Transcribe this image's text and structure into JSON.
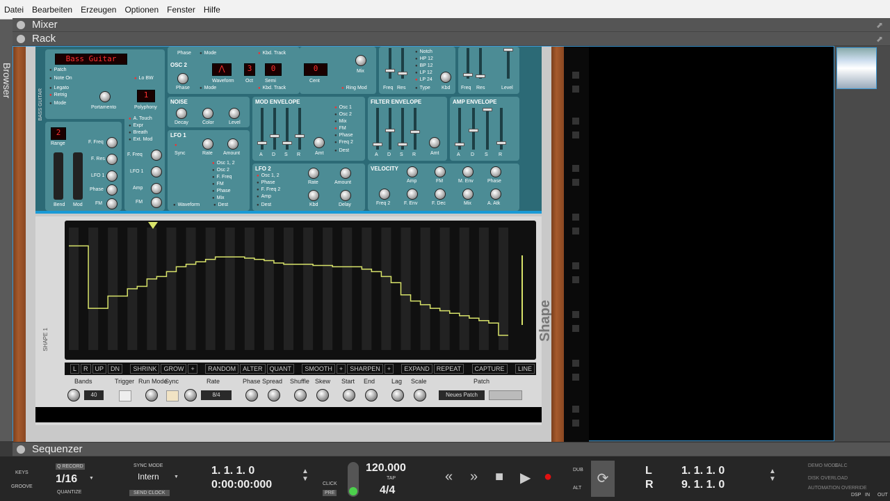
{
  "menu": [
    "Datei",
    "Bearbeiten",
    "Erzeugen",
    "Optionen",
    "Fenster",
    "Hilfe"
  ],
  "browser_label": "Browser",
  "sections": {
    "mixer": "Mixer",
    "rack": "Rack",
    "sequencer": "Sequenzer"
  },
  "synth": {
    "patch_name": "Bass Guitar",
    "patch_label": "Patch",
    "side_label": "BASS GUITAR",
    "polyphony_value": "1",
    "polyphony_label": "Polyphony",
    "range_value": "2",
    "range_label": "Range",
    "labels": {
      "note_on": "Note On",
      "lo_bw": "Lo BW",
      "legato": "Legato",
      "retrig": "Retrig",
      "mode": "Mode",
      "portamento": "Portamento",
      "a_touch": "A. Touch",
      "expr": "Expr",
      "breath": "Breath",
      "ext_mod": "Ext. Mod",
      "f_freq": "F. Freq",
      "f_res": "F. Res",
      "lfo1": "LFO 1",
      "phase": "Phase",
      "fm": "FM",
      "amp": "Amp",
      "bend": "Bend",
      "mod": "Mod"
    },
    "osc2": {
      "title": "OSC 2",
      "waveform": "Waveform",
      "oct": "Oct",
      "oct_value": "3",
      "semi": "Semi",
      "semi_value": "0",
      "cent": "Cent",
      "cent_value": "0",
      "kbd_track": "Kbd. Track",
      "ring_mod": "Ring Mod",
      "mix": "Mix",
      "phase": "Phase",
      "mode": "Mode"
    },
    "osc1_top": {
      "phase": "Phase",
      "mode": "Mode",
      "kbd_track": "Kbd. Track"
    },
    "noise": {
      "title": "NOISE",
      "decay": "Decay",
      "color": "Color",
      "level": "Level"
    },
    "lfo1": {
      "title": "LFO 1",
      "sync": "Sync",
      "rate": "Rate",
      "amount": "Amount",
      "waveform": "Waveform",
      "dest": "Dest",
      "dests": [
        "Osc 1, 2",
        "Osc 2",
        "F. Freq",
        "FM",
        "Phase",
        "Mix"
      ]
    },
    "filter_top": {
      "types": [
        "Notch",
        "HP 12",
        "BP 12",
        "LP 12",
        "LP 24"
      ],
      "freq": "Freq",
      "res": "Res",
      "type": "Type",
      "kbd": "Kbd",
      "freq2": "Freq",
      "res2": "Res",
      "level": "Level"
    },
    "mod_env": {
      "title": "MOD ENVELOPE",
      "dests": [
        "Osc 1",
        "Osc 2",
        "Mix",
        "FM",
        "Phase",
        "Freq 2"
      ],
      "dest": "Dest",
      "adsr": [
        "A",
        "D",
        "S",
        "R"
      ],
      "amt": "Amt"
    },
    "filter_env": {
      "title": "FILTER ENVELOPE",
      "adsr": [
        "A",
        "D",
        "S",
        "R"
      ],
      "amt": "Amt"
    },
    "amp_env": {
      "title": "AMP ENVELOPE",
      "adsr": [
        "A",
        "D",
        "S",
        "R"
      ]
    },
    "lfo2": {
      "title": "LFO 2",
      "dests": [
        "Osc 1, 2",
        "Phase",
        "F. Freq 2",
        "Amp"
      ],
      "dest": "Dest",
      "rate": "Rate",
      "amount": "Amount",
      "kbd": "Kbd",
      "delay": "Delay"
    },
    "velocity": {
      "title": "VELOCITY",
      "top": [
        "Amp",
        "FM",
        "M. Env",
        "Phase"
      ],
      "bottom": [
        "Freq 2",
        "F. Env",
        "F. Dec",
        "Mix",
        "A. Atk"
      ]
    }
  },
  "shape": {
    "side_label": "SHAPE 1",
    "logo": "Shape",
    "buttons_a": [
      "L",
      "R",
      "UP",
      "DN"
    ],
    "buttons_b": [
      "SHRINK",
      "GROW",
      "+"
    ],
    "buttons_c": [
      "RANDOM",
      "ALTER",
      "QUANT"
    ],
    "buttons_d": [
      "SMOOTH",
      "+",
      "SHARPEN",
      "+"
    ],
    "buttons_e": [
      "EXPAND",
      "REPEAT"
    ],
    "buttons_f": [
      "CAPTURE"
    ],
    "buttons_g": [
      "LINE"
    ],
    "controls": {
      "bands": "Bands",
      "bands_value": "40",
      "trigger": "Trigger",
      "run_mode": "Run Mode",
      "sync": "Sync",
      "rate": "Rate",
      "rate_value": "8/4",
      "phase": "Phase",
      "spread": "Spread",
      "shuffle": "Shuffle",
      "skew": "Skew",
      "start": "Start",
      "end": "End",
      "lag": "Lag",
      "scale": "Scale",
      "patch": "Patch",
      "patch_value": "Neues Patch"
    },
    "curve": [
      0.85,
      0.85,
      0.34,
      0.34,
      0.44,
      0.44,
      0.5,
      0.52,
      0.58,
      0.6,
      0.64,
      0.68,
      0.7,
      0.72,
      0.74,
      0.76,
      0.76,
      0.76,
      0.75,
      0.74,
      0.73,
      0.71,
      0.7,
      0.7,
      0.7,
      0.69,
      0.69,
      0.68,
      0.68,
      0.68,
      0.66,
      0.64,
      0.6,
      0.55,
      0.45,
      0.4,
      0.37,
      0.34,
      0.32,
      0.3,
      0.28,
      0.26,
      0.24,
      0.22,
      0.12
    ]
  },
  "transport": {
    "keys": "KEYS",
    "groove": "GROOVE",
    "q_record": "Q RECORD",
    "quantize_value": "1/16",
    "quantize": "QUANTIZE",
    "sync_mode": "SYNC MODE",
    "sync_value": "Intern",
    "send_clock": "SEND CLOCK",
    "position": "1.  1.  1.    0",
    "time": "0:00:00:000",
    "click": "CLICK",
    "pre": "PRE",
    "tempo": "120.000",
    "tap": "TAP",
    "signature": "4/4",
    "dub": "DUB",
    "alt": "ALT",
    "loop_l": "L",
    "loop_r": "R",
    "loop_l_pos": "1.  1.  1.    0",
    "loop_r_pos": "9.  1.  1.    0",
    "demo_mode": "DEMO MODE",
    "calc": "CALC",
    "disk_overload": "DISK OVERLOAD",
    "automation_override": "AUTOMATION OVERRIDE",
    "dsp": "DSP",
    "in": "IN",
    "out": "OUT"
  }
}
